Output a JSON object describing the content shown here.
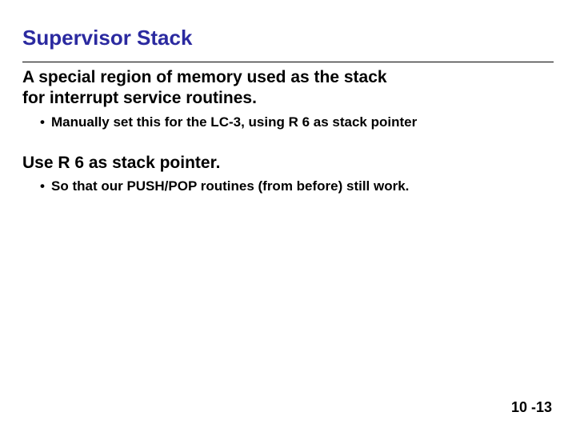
{
  "title": "Supervisor Stack",
  "para1_line1": "A special region of memory used as the stack",
  "para1_line2": "for interrupt service routines.",
  "bullet1": "Manually set this for the LC-3, using R 6 as stack pointer",
  "para2": "Use R 6 as stack pointer.",
  "bullet2": "So that our PUSH/POP routines (from before) still work.",
  "page_number": "10 -13",
  "dot": "•"
}
